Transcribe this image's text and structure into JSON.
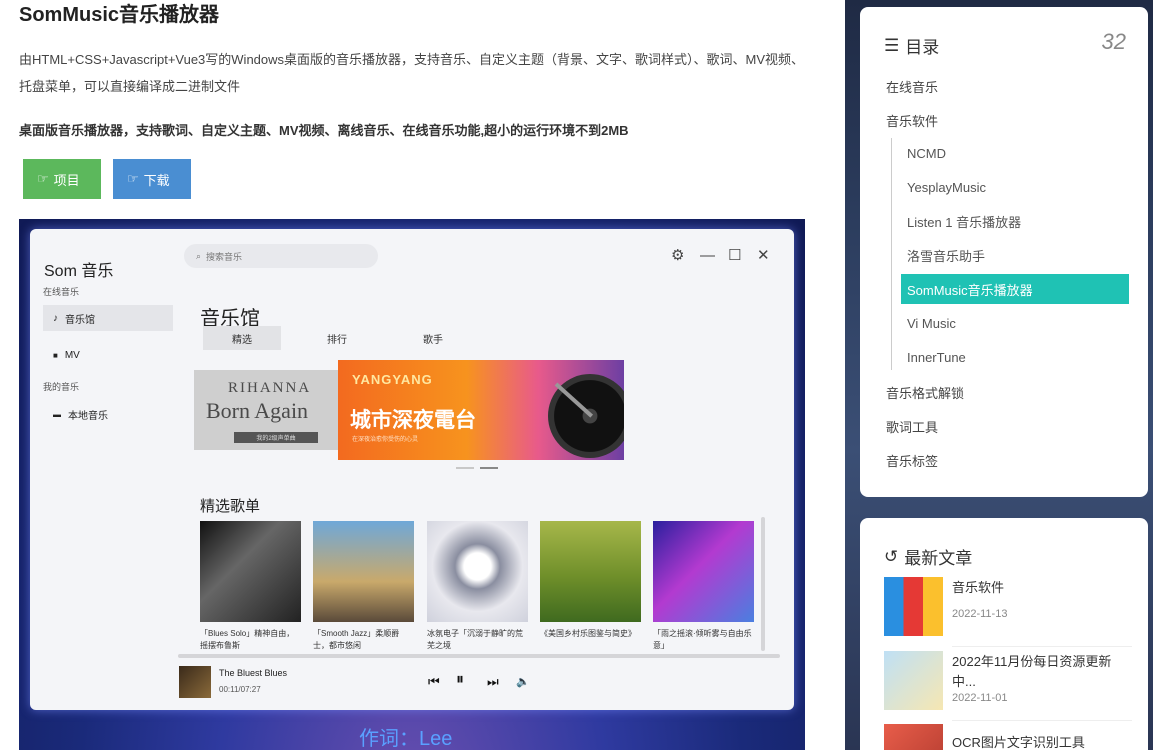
{
  "article": {
    "title": "SomMusic音乐播放器",
    "desc": "由HTML+CSS+Javascript+Vue3写的Windows桌面版的音乐播放器，支持音乐、自定义主题（背景、文字、歌词样式）、歌词、MV视频、托盘菜单，可以直接编译成二进制文件",
    "bold_prefix": "桌面版音乐播放器，",
    "bold_text": "支持歌词、自定义主题、MV视频、离线音乐、在线音乐功能,超小的运行环境不到2MB",
    "btn_project": "项目",
    "btn_download": "下载",
    "btn_project_color": "#5cb85c",
    "btn_download_color": "#4a8ed2"
  },
  "app": {
    "brand": "Som 音乐",
    "search_placeholder": "搜索音乐",
    "section_online": "在线音乐",
    "nav_hall": "音乐馆",
    "nav_mv": "MV",
    "section_mine": "我的音乐",
    "nav_local": "本地音乐",
    "page_title": "音乐馆",
    "tabs": [
      "精选",
      "排行",
      "歌手"
    ],
    "banner_left_1": "RIHANNA",
    "banner_left_2": "Born Again",
    "banner_left_3": "我的2级声单曲",
    "banner_yy": "YANGYANG",
    "banner_title": "城市深夜電台",
    "banner_sub": "在深夜治愈你受伤的心灵",
    "section_playlists": "精选歌单",
    "albums": [
      {
        "cap": "「Blues Solo」精神自由，摇摆布鲁斯"
      },
      {
        "cap": "「Smooth Jazz」柔顺爵士，都市悠闲"
      },
      {
        "cap": "冰氛电子「沉溺于静旷的荒芜之境"
      },
      {
        "cap": "《美国乡村乐图鉴与简史》"
      },
      {
        "cap": "「雨之摇滚·倾听雾与自由乐意」"
      }
    ],
    "player_song": "The Bluest Blues",
    "player_time": "00:11/07:27",
    "lyric": "作词：Lee"
  },
  "toc": {
    "title": "目录",
    "count": "32",
    "items": [
      "在线音乐",
      "音乐软件"
    ],
    "sub_items": [
      "NCMD",
      "YesplayMusic",
      "Listen 1 音乐播放器",
      "洛雪音乐助手",
      "SomMusic音乐播放器",
      "Vi Music",
      "InnerTune"
    ],
    "tail_items": [
      "音乐格式解锁",
      "歌词工具",
      "音乐标签"
    ],
    "active_color": "#1fc2b4"
  },
  "recent": {
    "title": "最新文章",
    "posts": [
      {
        "title": "音乐软件",
        "date": "2022-11-13"
      },
      {
        "title": "2022年11月份每日资源更新中...",
        "date": "2022-11-01"
      },
      {
        "title": "OCR图片文字识别工具",
        "date": ""
      }
    ]
  }
}
